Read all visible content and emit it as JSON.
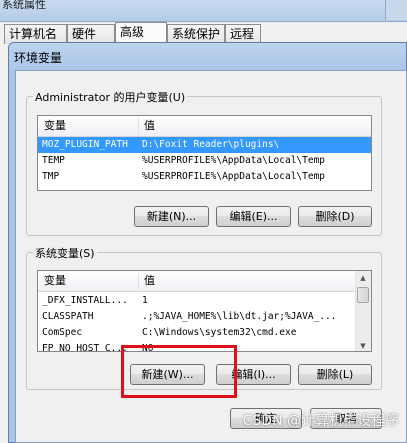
{
  "parent_window": {
    "title": "系统属性",
    "tabs": [
      {
        "label": "计算机名"
      },
      {
        "label": "硬件"
      },
      {
        "label": "高级"
      },
      {
        "label": "系统保护"
      },
      {
        "label": "远程"
      }
    ]
  },
  "dialog": {
    "title": "环境变量",
    "user_vars": {
      "group_label": "Administrator 的用户变量(U)",
      "col_variable": "变量",
      "col_value": "值",
      "rows": [
        {
          "name": "MOZ_PLUGIN_PATH",
          "value": "D:\\Foxit Reader\\plugins\\",
          "selected": true
        },
        {
          "name": "TEMP",
          "value": "%USERPROFILE%\\AppData\\Local\\Temp"
        },
        {
          "name": "TMP",
          "value": "%USERPROFILE%\\AppData\\Local\\Temp"
        }
      ],
      "new_button": "新建(N)...",
      "edit_button": "编辑(E)...",
      "delete_button": "删除(D)"
    },
    "system_vars": {
      "group_label": "系统变量(S)",
      "col_variable": "变量",
      "col_value": "值",
      "rows": [
        {
          "name": "_DFX_INSTALL...",
          "value": "1"
        },
        {
          "name": "CLASSPATH",
          "value": ".;%JAVA_HOME%\\lib\\dt.jar;%JAVA_..."
        },
        {
          "name": "ComSpec",
          "value": "C:\\Windows\\system32\\cmd.exe"
        },
        {
          "name": "FP_NO_HOST_C...",
          "value": "NO"
        }
      ],
      "new_button": "新建(W)...",
      "edit_button": "编辑(I)...",
      "delete_button": "删除(L)"
    },
    "ok_button": "确定",
    "cancel_button": "取消"
  },
  "watermark": "CSDN @计算机毕设程序",
  "colors": {
    "selection": "#3399ff",
    "highlight_box": "#e0101a",
    "title_gradient": "#bcd3ee"
  }
}
